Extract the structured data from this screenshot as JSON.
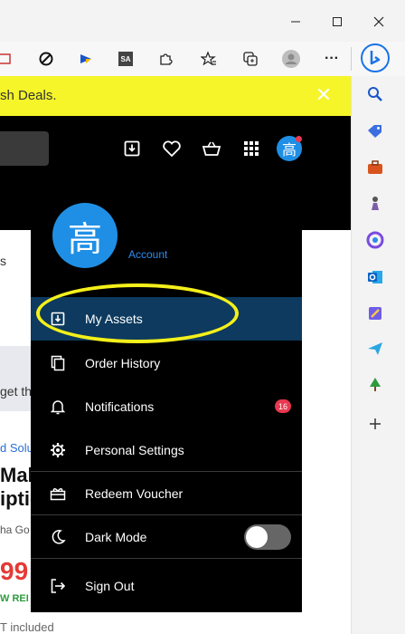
{
  "browser": {
    "window_controls": [
      "minimize",
      "maximize",
      "close"
    ],
    "toolbar_icons": [
      "collections-red-icon",
      "block-icon",
      "extension-blue-icon",
      "sa-extension-icon",
      "puzzle-icon",
      "favorites-icon",
      "collections-icon",
      "profile-icon",
      "more-icon"
    ],
    "more_label": "···"
  },
  "sidebar": {
    "icons": [
      "search-icon",
      "tag-icon",
      "toolbox-icon",
      "chess-icon",
      "office-icon",
      "outlook-icon",
      "designer-icon",
      "send-icon",
      "tree-icon",
      "add-icon"
    ]
  },
  "banner": {
    "text": "sh Deals.",
    "close_label": "✕"
  },
  "page_fragments": {
    "frag1": "s",
    "frag2": "get th",
    "frag3": "d Solu",
    "frag4": "Make",
    "frag5": "iptic",
    "frag6": "ha Go",
    "frag7": "99",
    "frag8": "W REI",
    "frag9": "T included"
  },
  "header": {
    "avatar_char": "高"
  },
  "account_menu": {
    "avatar_char": "高",
    "account_label": "Account",
    "items": [
      {
        "label": "My Assets",
        "icon": "download-box-icon",
        "active": true
      },
      {
        "label": "Order History",
        "icon": "copy-icon"
      },
      {
        "label": "Notifications",
        "icon": "bell-icon",
        "badge": "16"
      },
      {
        "label": "Personal Settings",
        "icon": "gear-icon"
      },
      {
        "label": "Redeem Voucher",
        "icon": "gift-icon"
      },
      {
        "label": "Dark Mode",
        "icon": "moon-icon",
        "toggle": false
      },
      {
        "label": "Sign Out",
        "icon": "sign-out-icon"
      }
    ]
  },
  "colors": {
    "banner": "#f5f529",
    "header": "#000000",
    "active_item": "#0d3a5e",
    "avatar": "#1f8fe5",
    "badge": "#e8384f",
    "highlight": "#f4f01a"
  }
}
